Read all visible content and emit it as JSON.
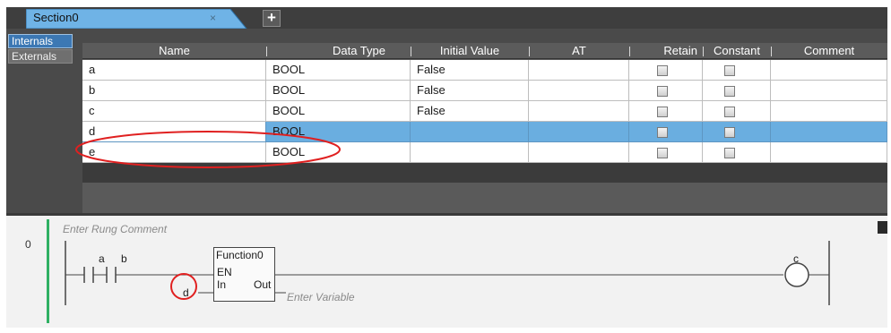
{
  "tab": {
    "label": "Section0",
    "close_glyph": "×",
    "add_glyph": "+"
  },
  "side_tabs": [
    "Internals",
    "Externals"
  ],
  "columns": [
    "Name",
    "Data Type",
    "Initial Value",
    "AT",
    "Retain",
    "Constant",
    "Comment"
  ],
  "rows": [
    {
      "name": "a",
      "type": "BOOL",
      "initial": "False",
      "at": "",
      "retain": false,
      "constant": false,
      "comment": ""
    },
    {
      "name": "b",
      "type": "BOOL",
      "initial": "False",
      "at": "",
      "retain": false,
      "constant": false,
      "comment": ""
    },
    {
      "name": "c",
      "type": "BOOL",
      "initial": "False",
      "at": "",
      "retain": false,
      "constant": false,
      "comment": ""
    },
    {
      "name": "d",
      "type": "BOOL",
      "initial": "",
      "at": "",
      "retain": false,
      "constant": false,
      "comment": "",
      "selected": true
    },
    {
      "name": "e",
      "type": "BOOL",
      "initial": "",
      "at": "",
      "retain": false,
      "constant": false,
      "comment": ""
    }
  ],
  "ladder": {
    "rung_number": "0",
    "rung_comment": "Enter Rung Comment",
    "contact_a": "a",
    "contact_b": "b",
    "function_name": "Function0",
    "pin_en": "EN",
    "pin_in": "In",
    "pin_out": "Out",
    "input_variable": "d",
    "output_placeholder": "Enter Variable",
    "coil": "c"
  },
  "colors": {
    "accent_blue": "#6aaee0",
    "rung_green": "#2fb063",
    "highlight_red": "#e02020"
  }
}
